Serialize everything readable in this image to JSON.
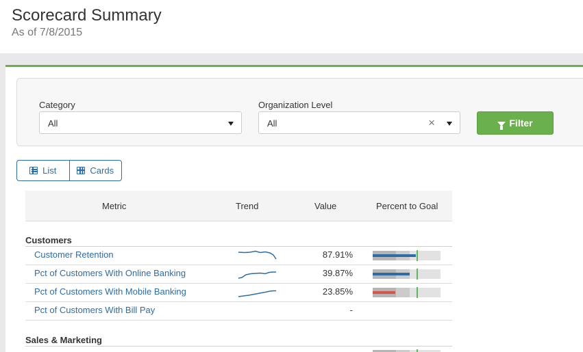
{
  "header": {
    "title": "Scorecard Summary",
    "subtitle": "As of 7/8/2015"
  },
  "filters": {
    "category_label": "Category",
    "category_value": "All",
    "org_label": "Organization Level",
    "org_value": "All",
    "filter_button": "Filter"
  },
  "view_toggle": {
    "list_label": "List",
    "cards_label": "Cards"
  },
  "table": {
    "columns": [
      "Metric",
      "Trend",
      "Value",
      "Percent to Goal"
    ],
    "groups": [
      {
        "name": "Customers",
        "rows": [
          {
            "metric": "Customer Retention",
            "value": "87.91%",
            "has_trend": true,
            "bar_pct": 0.64,
            "bar_color": "#2e6da4"
          },
          {
            "metric": "Pct of Customers With Online Banking",
            "value": "39.87%",
            "has_trend": true,
            "bar_pct": 0.55,
            "bar_color": "#2e6da4"
          },
          {
            "metric": "Pct of Customers With Mobile Banking",
            "value": "23.85%",
            "has_trend": true,
            "bar_pct": 0.33,
            "bar_color": "#d9534f"
          },
          {
            "metric": "Pct of Customers With Bill Pay",
            "value": "-",
            "has_trend": false
          }
        ]
      },
      {
        "name": "Sales & Marketing",
        "rows": []
      }
    ]
  },
  "colors": {
    "accent_green": "#6ab04c",
    "link_blue": "#2e6da4",
    "bar_blue": "#2e6da4",
    "bar_red": "#d9534f",
    "goal_green": "#5cb85c"
  },
  "icons": [
    "funnel-icon",
    "list-icon",
    "grid-icon",
    "chevron-down-icon",
    "close-icon"
  ]
}
